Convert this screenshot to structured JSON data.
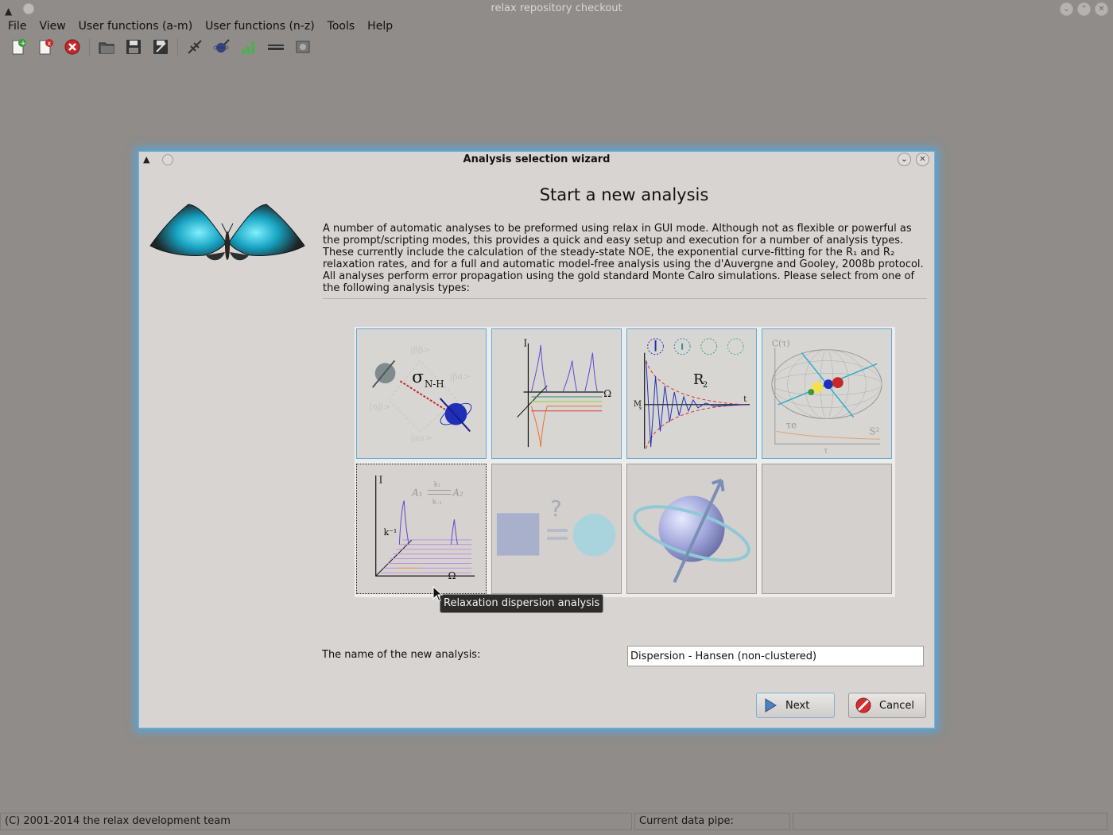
{
  "window": {
    "title": "relax repository checkout",
    "menus": [
      "File",
      "View",
      "User functions (a-m)",
      "User functions (n-z)",
      "Tools",
      "Help"
    ],
    "toolbar_icons": [
      "new-analysis-icon",
      "close-analysis-icon",
      "close-all-icon",
      "open-icon",
      "save-icon",
      "save-as-icon",
      "spectrometer-icon",
      "spin-viewer-icon",
      "results-viewer-icon",
      "pipe-editor-icon",
      "prompt-icon"
    ]
  },
  "status": {
    "copyright": "(C) 2001-2014 the relax development team",
    "pipe_label": "Current data pipe:",
    "pipe_value": ""
  },
  "dialog": {
    "title": "Analysis selection wizard",
    "heading": "Start a new analysis",
    "description_lines": [
      "A number of automatic analyses to be preformed using relax in GUI mode.  Although not as flexible or powerful as",
      "the prompt/scripting modes, this provides a quick and easy setup and execution for a number of analysis types.",
      "These currently include the calculation of the steady-state NOE, the exponential curve-fitting for the R₁ and R₂",
      "relaxation rates, and for a full and automatic model-free analysis using the d'Auvergne and Gooley, 2008b protocol.",
      "All analyses perform error propagation using the gold standard Monte Calro simulations.  Please select from one of",
      "the following analysis types:"
    ],
    "analysis_types": [
      {
        "icon": "noe-icon",
        "label_main": "σ",
        "label_sub": "N-H"
      },
      {
        "icon": "r1-icon",
        "axis_y": "I",
        "axis_x": "Ω"
      },
      {
        "icon": "r2-icon",
        "label": "R",
        "label_sub": "2",
        "axis_y": "M",
        "axis_y_sub": "x",
        "axis_x": "t"
      },
      {
        "icon": "model-free-icon",
        "axis_y": "C(τ)",
        "label_te": "τe",
        "label_s2": "S²",
        "axis_x": "τ"
      },
      {
        "icon": "relax-disp-icon",
        "axis_y": "I",
        "axis_x": "Ω",
        "k_label": "k⁻¹",
        "a1": "A₁",
        "a2": "A₂",
        "k1": "k₁",
        "km1": "k₋₁"
      },
      {
        "icon": "consistency-test-icon",
        "mark": "?"
      },
      {
        "icon": "custom-analysis-icon"
      },
      {
        "icon": "empty-slot"
      }
    ],
    "tooltip": "Relaxation dispersion analysis",
    "name_label": "The name of the new analysis:",
    "name_value": "Dispersion - Hansen (non-clustered)",
    "next_label": "Next",
    "cancel_label": "Cancel"
  }
}
